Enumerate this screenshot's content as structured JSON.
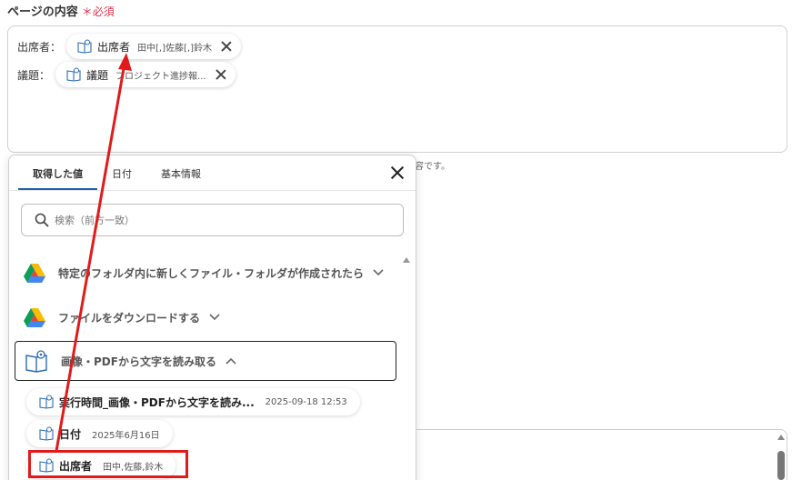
{
  "field": {
    "label": "ページの内容",
    "required_mark": "＊",
    "required_label": "必須"
  },
  "tokens": [
    {
      "field_label": "出席者：",
      "label": "出席者",
      "value": "田中[,]佐藤[,]鈴木"
    },
    {
      "field_label": "議題：",
      "label": "議題",
      "value": "プロジェクト進捗報..."
    }
  ],
  "hint_text": "容です。",
  "popup": {
    "tabs": [
      "取得した値",
      "日付",
      "基本情報"
    ],
    "active_tab": "取得した値",
    "search_placeholder": "検索（前方一致）",
    "sections": [
      {
        "title": "特定のフォルダ内に新しくファイル・フォルダが作成されたら",
        "icon": "google-drive-icon",
        "expanded": false
      },
      {
        "title": "ファイルをダウンロードする",
        "icon": "google-drive-icon",
        "expanded": false
      },
      {
        "title": "画像・PDFから文字を読み取る",
        "icon": "ocr-book-icon",
        "expanded": true
      }
    ],
    "items": [
      {
        "label": "実行時間_画像・PDFから文字を読み...",
        "value": "2025-09-18 12:53"
      },
      {
        "label": "日付",
        "value": "2025年6月16日"
      },
      {
        "label": "出席者",
        "value": "田中,佐藤,鈴木"
      }
    ]
  },
  "colors": {
    "accent": "#1d5fb0",
    "required": "#e0334c",
    "annotation": "#e01b1b"
  }
}
